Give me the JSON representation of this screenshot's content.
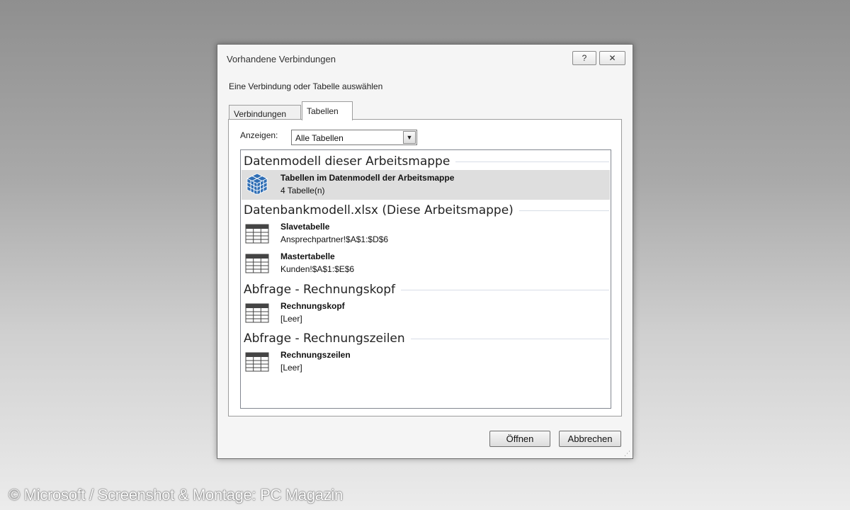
{
  "dialog": {
    "title": "Vorhandene Verbindungen",
    "help_label": "?",
    "close_label": "✕",
    "prompt": "Eine Verbindung oder Tabelle auswählen",
    "tabs": [
      {
        "label": "Verbindungen",
        "selected": false
      },
      {
        "label": "Tabellen",
        "selected": true
      }
    ],
    "show_label": "Anzeigen:",
    "show_value": "Alle Tabellen",
    "groups": [
      {
        "header": "Datenmodell dieser Arbeitsmappe",
        "items": [
          {
            "name": "Tabellen im Datenmodell der Arbeitsmappe",
            "sub": "4 Tabelle(n)",
            "icon": "cube-icon",
            "selected": true
          }
        ]
      },
      {
        "header": "Datenbankmodell.xlsx (Diese Arbeitsmappe)",
        "items": [
          {
            "name": "Slavetabelle",
            "sub": "Ansprechpartner!$A$1:$D$6",
            "icon": "table-icon"
          },
          {
            "name": "Mastertabelle",
            "sub": "Kunden!$A$1:$E$6",
            "icon": "table-icon"
          }
        ]
      },
      {
        "header": "Abfrage - Rechnungskopf",
        "items": [
          {
            "name": "Rechnungskopf",
            "sub": "[Leer]",
            "icon": "table-icon"
          }
        ]
      },
      {
        "header": "Abfrage - Rechnungszeilen",
        "items": [
          {
            "name": "Rechnungszeilen",
            "sub": "[Leer]",
            "icon": "table-icon"
          }
        ]
      }
    ],
    "open_label": "Öffnen",
    "cancel_label": "Abbrechen"
  },
  "credit": "© Microsoft / Screenshot & Montage: PC Magazin",
  "colors": {
    "selection": "#dedede",
    "cube_blue": "#2f6eb5",
    "group_line": "#d8dde6"
  }
}
